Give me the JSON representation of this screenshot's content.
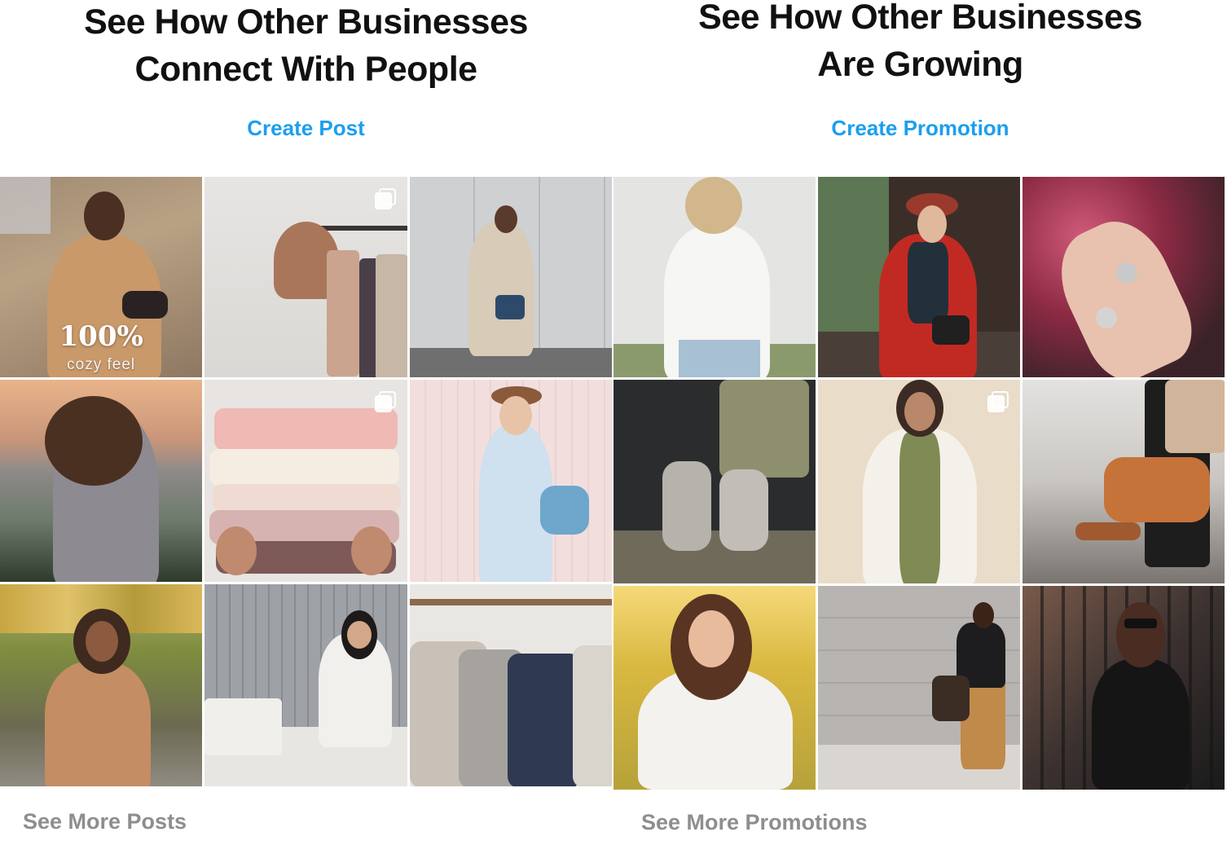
{
  "posts_panel": {
    "heading_line1": "See How Other Businesses",
    "heading_line2": "Connect With People",
    "cta_label": "Create Post",
    "more_label": "See More Posts",
    "tiles": [
      {
        "name": "tile-man-camel-coat",
        "overlay_big": "100%",
        "overlay_small": "cozy feel",
        "multi": false
      },
      {
        "name": "tile-hat-on-clothes-rack",
        "multi": true
      },
      {
        "name": "tile-woman-walking-trench-coat",
        "multi": false
      },
      {
        "name": "tile-woman-hair-sunset",
        "multi": false
      },
      {
        "name": "tile-stacked-knit-sweaters",
        "multi": true
      },
      {
        "name": "tile-woman-white-dress-hat",
        "multi": false
      },
      {
        "name": "tile-woman-park-coffee",
        "multi": false
      },
      {
        "name": "tile-woman-sewing-studio",
        "multi": false
      },
      {
        "name": "tile-knitwear-on-hangers",
        "multi": false
      }
    ]
  },
  "promotions_panel": {
    "heading_line1": "See How Other Businesses",
    "heading_line2": "Are Growing",
    "cta_label": "Create Promotion",
    "more_label": "See More Promotions",
    "tiles": [
      {
        "name": "tile-woman-white-sweater",
        "multi": false
      },
      {
        "name": "tile-woman-red-fur-jacket",
        "multi": false
      },
      {
        "name": "tile-hand-rings-flowers",
        "multi": false
      },
      {
        "name": "tile-man-socks-car",
        "multi": false
      },
      {
        "name": "tile-woman-cream-cardigan",
        "multi": true
      },
      {
        "name": "tile-leather-duffel-bag",
        "multi": false
      },
      {
        "name": "tile-woman-field-sunlight",
        "multi": false
      },
      {
        "name": "tile-man-walking-tote",
        "multi": false
      },
      {
        "name": "tile-woman-sunglasses-fence",
        "multi": false
      }
    ]
  }
}
